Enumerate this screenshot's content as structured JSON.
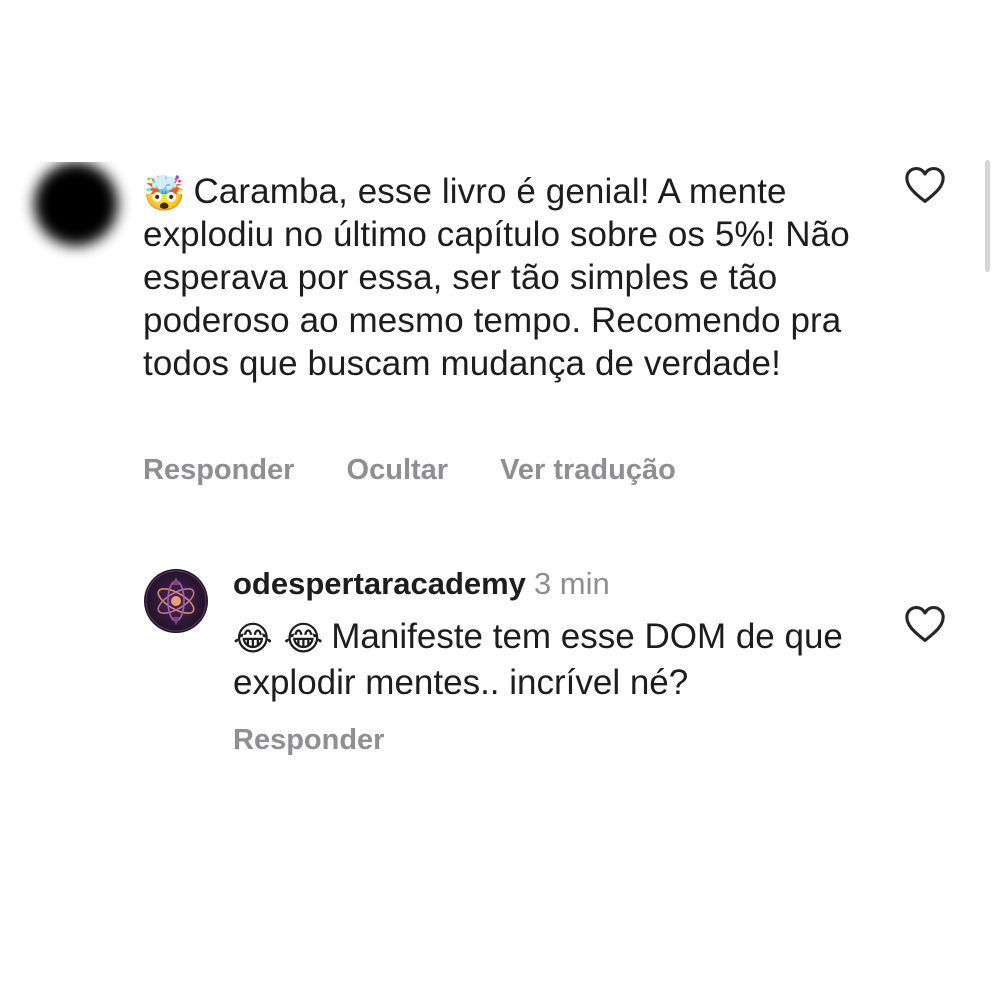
{
  "comment": {
    "emoji": "🤯",
    "text": "Caramba, esse livro é genial! A mente explodiu no último capítulo sobre os 5%! Não esperava por essa, ser tão simples e tão poderoso ao mesmo tempo. Recomendo pra todos que buscam mudança de verdade!",
    "actions": {
      "reply": "Responder",
      "hide": "Ocultar",
      "translate": "Ver tradução"
    },
    "liked": false
  },
  "reply": {
    "username": "odespertaracademy",
    "time": "3 min",
    "emoji": "😂 😂",
    "text": "Manifeste tem esse DOM de que explodir mentes.. incrível né?",
    "actions": {
      "reply": "Responder"
    },
    "liked": false
  },
  "icons": {
    "like": "heart-outline-icon"
  },
  "colors": {
    "secondary_text": "#8e8e93",
    "primary_text": "#1d1d1d"
  }
}
